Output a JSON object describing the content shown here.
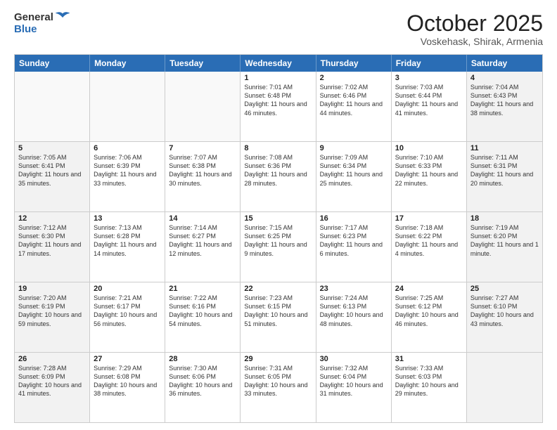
{
  "logo": {
    "general": "General",
    "blue": "Blue"
  },
  "title": "October 2025",
  "subtitle": "Voskehask, Shirak, Armenia",
  "header_days": [
    "Sunday",
    "Monday",
    "Tuesday",
    "Wednesday",
    "Thursday",
    "Friday",
    "Saturday"
  ],
  "rows": [
    [
      {
        "day": "",
        "sunrise": "",
        "sunset": "",
        "daylight": "",
        "shaded": false,
        "empty": true
      },
      {
        "day": "",
        "sunrise": "",
        "sunset": "",
        "daylight": "",
        "shaded": false,
        "empty": true
      },
      {
        "day": "",
        "sunrise": "",
        "sunset": "",
        "daylight": "",
        "shaded": false,
        "empty": true
      },
      {
        "day": "1",
        "sunrise": "Sunrise: 7:01 AM",
        "sunset": "Sunset: 6:48 PM",
        "daylight": "Daylight: 11 hours and 46 minutes.",
        "shaded": false,
        "empty": false
      },
      {
        "day": "2",
        "sunrise": "Sunrise: 7:02 AM",
        "sunset": "Sunset: 6:46 PM",
        "daylight": "Daylight: 11 hours and 44 minutes.",
        "shaded": false,
        "empty": false
      },
      {
        "day": "3",
        "sunrise": "Sunrise: 7:03 AM",
        "sunset": "Sunset: 6:44 PM",
        "daylight": "Daylight: 11 hours and 41 minutes.",
        "shaded": false,
        "empty": false
      },
      {
        "day": "4",
        "sunrise": "Sunrise: 7:04 AM",
        "sunset": "Sunset: 6:43 PM",
        "daylight": "Daylight: 11 hours and 38 minutes.",
        "shaded": true,
        "empty": false
      }
    ],
    [
      {
        "day": "5",
        "sunrise": "Sunrise: 7:05 AM",
        "sunset": "Sunset: 6:41 PM",
        "daylight": "Daylight: 11 hours and 35 minutes.",
        "shaded": true,
        "empty": false
      },
      {
        "day": "6",
        "sunrise": "Sunrise: 7:06 AM",
        "sunset": "Sunset: 6:39 PM",
        "daylight": "Daylight: 11 hours and 33 minutes.",
        "shaded": false,
        "empty": false
      },
      {
        "day": "7",
        "sunrise": "Sunrise: 7:07 AM",
        "sunset": "Sunset: 6:38 PM",
        "daylight": "Daylight: 11 hours and 30 minutes.",
        "shaded": false,
        "empty": false
      },
      {
        "day": "8",
        "sunrise": "Sunrise: 7:08 AM",
        "sunset": "Sunset: 6:36 PM",
        "daylight": "Daylight: 11 hours and 28 minutes.",
        "shaded": false,
        "empty": false
      },
      {
        "day": "9",
        "sunrise": "Sunrise: 7:09 AM",
        "sunset": "Sunset: 6:34 PM",
        "daylight": "Daylight: 11 hours and 25 minutes.",
        "shaded": false,
        "empty": false
      },
      {
        "day": "10",
        "sunrise": "Sunrise: 7:10 AM",
        "sunset": "Sunset: 6:33 PM",
        "daylight": "Daylight: 11 hours and 22 minutes.",
        "shaded": false,
        "empty": false
      },
      {
        "day": "11",
        "sunrise": "Sunrise: 7:11 AM",
        "sunset": "Sunset: 6:31 PM",
        "daylight": "Daylight: 11 hours and 20 minutes.",
        "shaded": true,
        "empty": false
      }
    ],
    [
      {
        "day": "12",
        "sunrise": "Sunrise: 7:12 AM",
        "sunset": "Sunset: 6:30 PM",
        "daylight": "Daylight: 11 hours and 17 minutes.",
        "shaded": true,
        "empty": false
      },
      {
        "day": "13",
        "sunrise": "Sunrise: 7:13 AM",
        "sunset": "Sunset: 6:28 PM",
        "daylight": "Daylight: 11 hours and 14 minutes.",
        "shaded": false,
        "empty": false
      },
      {
        "day": "14",
        "sunrise": "Sunrise: 7:14 AM",
        "sunset": "Sunset: 6:27 PM",
        "daylight": "Daylight: 11 hours and 12 minutes.",
        "shaded": false,
        "empty": false
      },
      {
        "day": "15",
        "sunrise": "Sunrise: 7:15 AM",
        "sunset": "Sunset: 6:25 PM",
        "daylight": "Daylight: 11 hours and 9 minutes.",
        "shaded": false,
        "empty": false
      },
      {
        "day": "16",
        "sunrise": "Sunrise: 7:17 AM",
        "sunset": "Sunset: 6:23 PM",
        "daylight": "Daylight: 11 hours and 6 minutes.",
        "shaded": false,
        "empty": false
      },
      {
        "day": "17",
        "sunrise": "Sunrise: 7:18 AM",
        "sunset": "Sunset: 6:22 PM",
        "daylight": "Daylight: 11 hours and 4 minutes.",
        "shaded": false,
        "empty": false
      },
      {
        "day": "18",
        "sunrise": "Sunrise: 7:19 AM",
        "sunset": "Sunset: 6:20 PM",
        "daylight": "Daylight: 11 hours and 1 minute.",
        "shaded": true,
        "empty": false
      }
    ],
    [
      {
        "day": "19",
        "sunrise": "Sunrise: 7:20 AM",
        "sunset": "Sunset: 6:19 PM",
        "daylight": "Daylight: 10 hours and 59 minutes.",
        "shaded": true,
        "empty": false
      },
      {
        "day": "20",
        "sunrise": "Sunrise: 7:21 AM",
        "sunset": "Sunset: 6:17 PM",
        "daylight": "Daylight: 10 hours and 56 minutes.",
        "shaded": false,
        "empty": false
      },
      {
        "day": "21",
        "sunrise": "Sunrise: 7:22 AM",
        "sunset": "Sunset: 6:16 PM",
        "daylight": "Daylight: 10 hours and 54 minutes.",
        "shaded": false,
        "empty": false
      },
      {
        "day": "22",
        "sunrise": "Sunrise: 7:23 AM",
        "sunset": "Sunset: 6:15 PM",
        "daylight": "Daylight: 10 hours and 51 minutes.",
        "shaded": false,
        "empty": false
      },
      {
        "day": "23",
        "sunrise": "Sunrise: 7:24 AM",
        "sunset": "Sunset: 6:13 PM",
        "daylight": "Daylight: 10 hours and 48 minutes.",
        "shaded": false,
        "empty": false
      },
      {
        "day": "24",
        "sunrise": "Sunrise: 7:25 AM",
        "sunset": "Sunset: 6:12 PM",
        "daylight": "Daylight: 10 hours and 46 minutes.",
        "shaded": false,
        "empty": false
      },
      {
        "day": "25",
        "sunrise": "Sunrise: 7:27 AM",
        "sunset": "Sunset: 6:10 PM",
        "daylight": "Daylight: 10 hours and 43 minutes.",
        "shaded": true,
        "empty": false
      }
    ],
    [
      {
        "day": "26",
        "sunrise": "Sunrise: 7:28 AM",
        "sunset": "Sunset: 6:09 PM",
        "daylight": "Daylight: 10 hours and 41 minutes.",
        "shaded": true,
        "empty": false
      },
      {
        "day": "27",
        "sunrise": "Sunrise: 7:29 AM",
        "sunset": "Sunset: 6:08 PM",
        "daylight": "Daylight: 10 hours and 38 minutes.",
        "shaded": false,
        "empty": false
      },
      {
        "day": "28",
        "sunrise": "Sunrise: 7:30 AM",
        "sunset": "Sunset: 6:06 PM",
        "daylight": "Daylight: 10 hours and 36 minutes.",
        "shaded": false,
        "empty": false
      },
      {
        "day": "29",
        "sunrise": "Sunrise: 7:31 AM",
        "sunset": "Sunset: 6:05 PM",
        "daylight": "Daylight: 10 hours and 33 minutes.",
        "shaded": false,
        "empty": false
      },
      {
        "day": "30",
        "sunrise": "Sunrise: 7:32 AM",
        "sunset": "Sunset: 6:04 PM",
        "daylight": "Daylight: 10 hours and 31 minutes.",
        "shaded": false,
        "empty": false
      },
      {
        "day": "31",
        "sunrise": "Sunrise: 7:33 AM",
        "sunset": "Sunset: 6:03 PM",
        "daylight": "Daylight: 10 hours and 29 minutes.",
        "shaded": false,
        "empty": false
      },
      {
        "day": "",
        "sunrise": "",
        "sunset": "",
        "daylight": "",
        "shaded": true,
        "empty": true
      }
    ]
  ]
}
